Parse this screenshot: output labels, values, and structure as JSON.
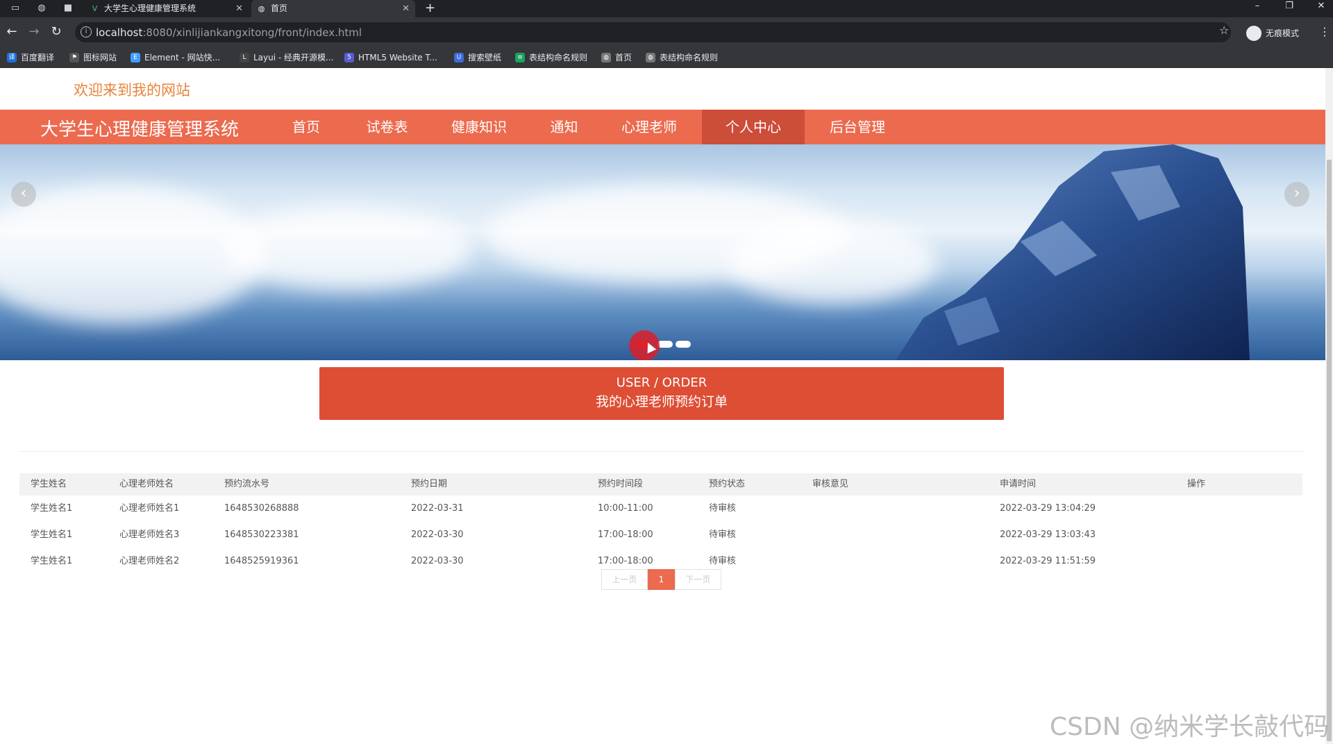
{
  "browser": {
    "tabs": [
      {
        "title": "大学生心理健康管理系统",
        "favicon": "vue-logo-icon"
      },
      {
        "title": "首页",
        "favicon": "globe-icon"
      }
    ],
    "url_host": "localhost",
    "url_path": ":8080/xinlijiankangxitong/front/index.html",
    "incognito_label": "无痕模式",
    "bookmarks": [
      {
        "label": "百度翻译",
        "color": "#1e6fd9"
      },
      {
        "label": "图标网站",
        "color": "#555555"
      },
      {
        "label": "Element - 网站快...",
        "color": "#409eff"
      },
      {
        "label": "Layui - 经典开源模...",
        "color": "#444444"
      },
      {
        "label": "HTML5 Website T...",
        "color": "#5b5bd6"
      },
      {
        "label": "搜索壁纸",
        "color": "#3d6cd9"
      },
      {
        "label": "表结构命名规则",
        "color": "#1aa260"
      },
      {
        "label": "首页",
        "color": "#777777"
      },
      {
        "label": "表结构命名规则",
        "color": "#777777"
      }
    ]
  },
  "site": {
    "welcome": "欢迎来到我的网站",
    "brand": "大学生心理健康管理系统",
    "nav": [
      "首页",
      "试卷表",
      "健康知识",
      "通知",
      "心理老师",
      "个人中心",
      "后台管理"
    ],
    "active_nav": "个人中心",
    "accent_color": "#ec6a4e"
  },
  "carousel": {
    "slides": 3,
    "active_slide": 1
  },
  "order_banner": {
    "title_en": "USER / ORDER",
    "title_cn": "我的心理老师预约订单"
  },
  "table": {
    "columns": [
      "学生姓名",
      "心理老师姓名",
      "预约流水号",
      "预约日期",
      "预约时间段",
      "预约状态",
      "审核意见",
      "申请时间",
      "操作"
    ],
    "rows": [
      [
        "学生姓名1",
        "心理老师姓名1",
        "1648530268888",
        "2022-03-31",
        "10:00-11:00",
        "待审核",
        "",
        "2022-03-29 13:04:29",
        ""
      ],
      [
        "学生姓名1",
        "心理老师姓名3",
        "1648530223381",
        "2022-03-30",
        "17:00-18:00",
        "待审核",
        "",
        "2022-03-29 13:03:43",
        ""
      ],
      [
        "学生姓名1",
        "心理老师姓名2",
        "1648525919361",
        "2022-03-30",
        "17:00-18:00",
        "待审核",
        "",
        "2022-03-29 11:51:59",
        ""
      ]
    ]
  },
  "pagination": {
    "prev": "上一页",
    "current": "1",
    "next": "下一页"
  },
  "watermark": "CSDN @纳米学长敲代码"
}
